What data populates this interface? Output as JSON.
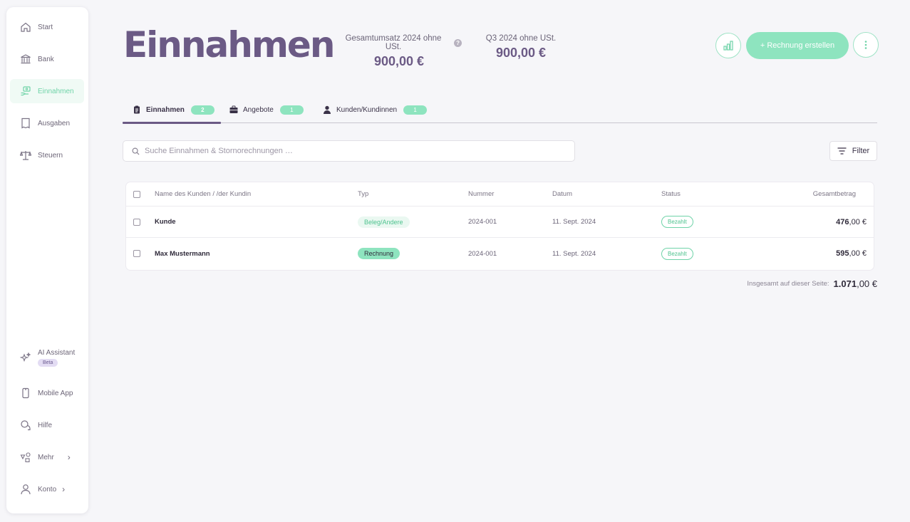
{
  "sidebar": {
    "top_items": [
      {
        "label": "Start",
        "icon": "home-icon"
      },
      {
        "label": "Bank",
        "icon": "bank-icon"
      },
      {
        "label": "Einnahmen",
        "icon": "income-icon",
        "active": true
      },
      {
        "label": "Ausgaben",
        "icon": "receipt-icon"
      },
      {
        "label": "Steuern",
        "icon": "scale-icon"
      }
    ],
    "bottom_items": [
      {
        "label": "AI Assistant",
        "badge": "Beta",
        "icon": "sparkle-icon"
      },
      {
        "label": "Mobile App",
        "icon": "phone-icon"
      },
      {
        "label": "Hilfe",
        "icon": "chat-icon"
      },
      {
        "label": "Mehr",
        "icon": "shapes-icon"
      },
      {
        "label": "Konto",
        "icon": "user-icon"
      }
    ]
  },
  "header": {
    "title": "Einnahmen",
    "stats": [
      {
        "label": "Gesamtumsatz 2024 ohne USt.",
        "value": "900,00 €",
        "help": "?"
      },
      {
        "label": "Q3 2024 ohne USt.",
        "value": "900,00 €"
      }
    ],
    "create_invoice_label": "+ Rechnung erstellen"
  },
  "tabs": [
    {
      "label": "Einnahmen",
      "count": "2",
      "icon": "clipboard-icon",
      "active": true
    },
    {
      "label": "Angebote",
      "count": "1",
      "icon": "briefcase-icon"
    },
    {
      "label": "Kunden/Kundinnen",
      "count": "1",
      "icon": "person-icon"
    }
  ],
  "search": {
    "placeholder": "Suche Einnahmen & Stornorechnungen …",
    "value": ""
  },
  "filter_label": "Filter",
  "table": {
    "columns": {
      "name": "Name des Kunden / /der Kundin",
      "type": "Typ",
      "number": "Nummer",
      "date": "Datum",
      "status": "Status",
      "total": "Gesamtbetrag"
    },
    "rows": [
      {
        "name": "Kunde",
        "type": "Beleg/Andere",
        "number": "2024-001",
        "date": "11. Sept. 2024",
        "status": "Bezahlt",
        "amount_int": "476",
        "amount_dec": ",00 €"
      },
      {
        "name": "Max Mustermann",
        "type": "Rechnung",
        "number": "2024-001",
        "date": "11. Sept. 2024",
        "status": "Bezahlt",
        "amount_int": "595",
        "amount_dec": ",00 €"
      }
    ]
  },
  "page_total": {
    "label": "Insgesamt auf dieser Seite:",
    "value_int": "1.071",
    "value_dec": ",00 €"
  },
  "colors": {
    "accent": "#8ee4bf",
    "title": "#6b5a85"
  }
}
